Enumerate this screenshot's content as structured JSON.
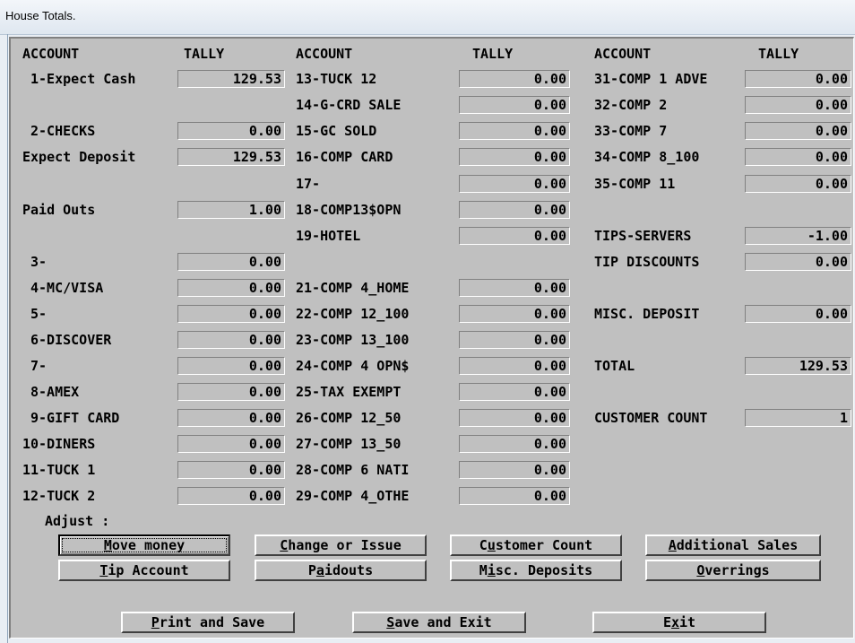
{
  "window": {
    "title": "House Totals."
  },
  "headers": {
    "account": "ACCOUNT",
    "tally": "TALLY"
  },
  "col1": [
    {
      "label": "1-Expect Cash",
      "value": "129.53"
    },
    {
      "label": "2-CHECKS",
      "value": "0.00"
    },
    {
      "label": "Expect Deposit",
      "value": "129.53"
    },
    {
      "label": "Paid Outs",
      "value": "1.00"
    },
    {
      "label": "3-",
      "value": "0.00"
    },
    {
      "label": "4-MC/VISA",
      "value": "0.00"
    },
    {
      "label": "5-",
      "value": "0.00"
    },
    {
      "label": "6-DISCOVER",
      "value": "0.00"
    },
    {
      "label": "7-",
      "value": "0.00"
    },
    {
      "label": "8-AMEX",
      "value": "0.00"
    },
    {
      "label": "9-GIFT CARD",
      "value": "0.00"
    },
    {
      "label": "10-DINERS",
      "value": "0.00"
    },
    {
      "label": "11-TUCK 1",
      "value": "0.00"
    },
    {
      "label": "12-TUCK 2",
      "value": "0.00"
    }
  ],
  "col2": [
    {
      "label": "13-TUCK 12",
      "value": "0.00"
    },
    {
      "label": "14-G-CRD SALE",
      "value": "0.00"
    },
    {
      "label": "15-GC SOLD",
      "value": "0.00"
    },
    {
      "label": "16-COMP CARD",
      "value": "0.00"
    },
    {
      "label": "17-",
      "value": "0.00"
    },
    {
      "label": "18-COMP13$OPN",
      "value": "0.00"
    },
    {
      "label": "19-HOTEL",
      "value": "0.00"
    },
    {
      "label": "21-COMP 4_HOME",
      "value": "0.00"
    },
    {
      "label": "22-COMP 12_100",
      "value": "0.00"
    },
    {
      "label": "23-COMP 13_100",
      "value": "0.00"
    },
    {
      "label": "24-COMP 4 OPN$",
      "value": "0.00"
    },
    {
      "label": "25-TAX EXEMPT",
      "value": "0.00"
    },
    {
      "label": "26-COMP 12_50",
      "value": "0.00"
    },
    {
      "label": "27-COMP 13_50",
      "value": "0.00"
    },
    {
      "label": "28-COMP 6 NATI",
      "value": "0.00"
    },
    {
      "label": "29-COMP 4_OTHE",
      "value": "0.00"
    }
  ],
  "col3": [
    {
      "label": "31-COMP 1 ADVE",
      "value": "0.00"
    },
    {
      "label": "32-COMP 2",
      "value": "0.00"
    },
    {
      "label": "33-COMP 7",
      "value": "0.00"
    },
    {
      "label": "34-COMP 8_100",
      "value": "0.00"
    },
    {
      "label": "35-COMP 11",
      "value": "0.00"
    },
    {
      "label": "TIPS-SERVERS",
      "value": "-1.00"
    },
    {
      "label": "TIP DISCOUNTS",
      "value": "0.00"
    },
    {
      "label": "MISC. DEPOSIT",
      "value": "0.00"
    },
    {
      "label": "TOTAL",
      "value": "129.53"
    },
    {
      "label": "CUSTOMER COUNT",
      "value": "1"
    }
  ],
  "adjust_label": "Adjust :",
  "buttons": {
    "move_money": {
      "pre": "",
      "key": "M",
      "post": "ove money"
    },
    "change_issue": {
      "pre": "",
      "key": "C",
      "post": "hange or Issue"
    },
    "customer_count": {
      "pre": "C",
      "key": "u",
      "post": "stomer Count"
    },
    "additional_sales": {
      "pre": "",
      "key": "A",
      "post": "dditional Sales"
    },
    "tip_account": {
      "pre": "",
      "key": "T",
      "post": "ip Account"
    },
    "paidouts": {
      "pre": "P",
      "key": "a",
      "post": "idouts"
    },
    "misc_deposits": {
      "pre": "M",
      "key": "i",
      "post": "sc. Deposits"
    },
    "overrings": {
      "pre": "",
      "key": "O",
      "post": "verrings"
    },
    "print_save": {
      "pre": "",
      "key": "P",
      "post": "rint and Save"
    },
    "save_exit": {
      "pre": "",
      "key": "S",
      "post": "ave and Exit"
    },
    "exit": {
      "pre": "E",
      "key": "x",
      "post": "it"
    }
  }
}
